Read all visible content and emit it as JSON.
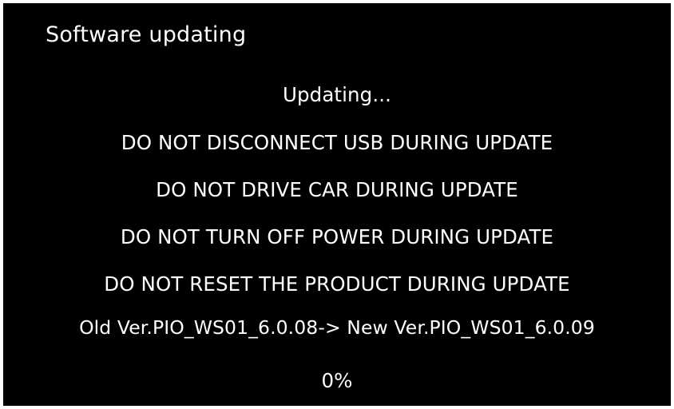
{
  "screen": {
    "title": "Software updating",
    "status": "Updating...",
    "warnings": [
      "DO NOT DISCONNECT USB DURING UPDATE",
      "DO NOT DRIVE CAR DURING UPDATE",
      "DO NOT TURN OFF POWER DURING UPDATE",
      "DO NOT RESET THE PRODUCT DURING UPDATE"
    ],
    "version_line": "Old Ver.PIO_WS01_6.0.08-> New Ver.PIO_WS01_6.0.09",
    "progress_text": "0%"
  },
  "colors": {
    "background": "#000000",
    "text": "#ffffff"
  }
}
